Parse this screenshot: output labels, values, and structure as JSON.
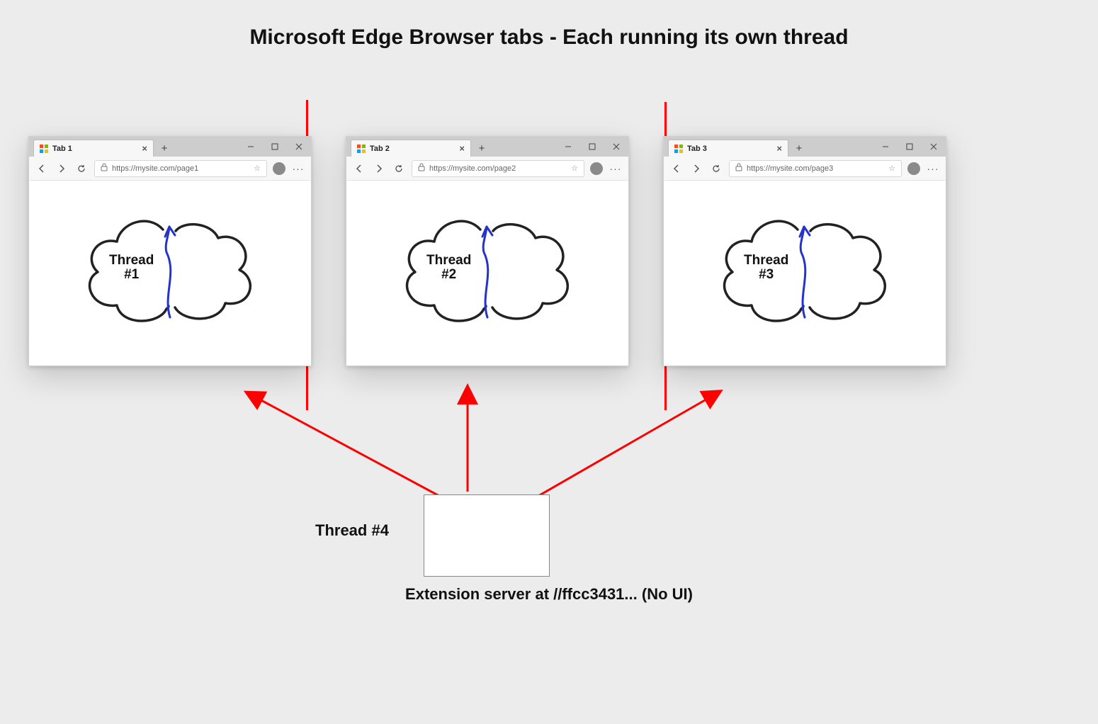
{
  "title": "Microsoft Edge Browser tabs - Each running its own thread",
  "browsers": [
    {
      "tab_title": "Tab 1",
      "url": "https://mysite.com/page1",
      "thread_label_l1": "Thread",
      "thread_label_l2": "#1"
    },
    {
      "tab_title": "Tab 2",
      "url": "https://mysite.com/page2",
      "thread_label_l1": "Thread",
      "thread_label_l2": "#2"
    },
    {
      "tab_title": "Tab 3",
      "url": "https://mysite.com/page3",
      "thread_label_l1": "Thread",
      "thread_label_l2": "#3"
    }
  ],
  "thread4_label": "Thread #4",
  "extension_caption": "Extension server at //ffcc3431... (No UI)"
}
